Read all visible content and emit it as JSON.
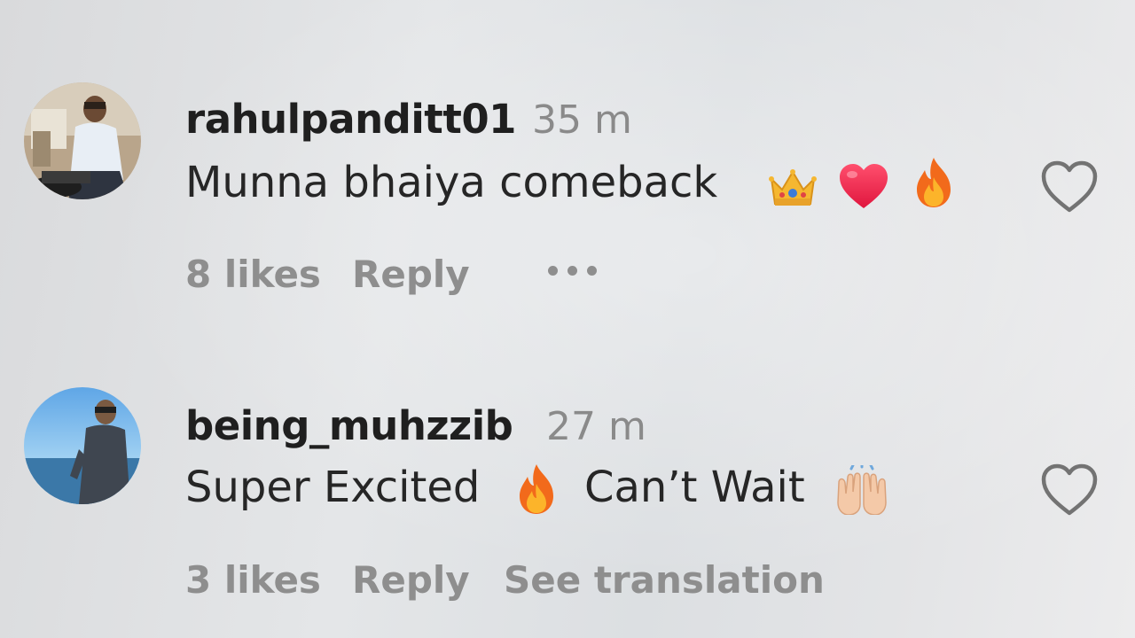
{
  "comments": [
    {
      "username": "rahulpanditt01",
      "time": "35 m",
      "text": "Munna bhaiya comeback",
      "emojis": [
        "crown-emoji",
        "red-heart-emoji",
        "fire-emoji"
      ],
      "likes": "8 likes",
      "reply": "Reply",
      "avatar_icon": "avatar-photo"
    },
    {
      "username": "being_muhzzib",
      "time": "27 m",
      "text_part1": "Super Excited",
      "text_part2": "Can’t Wait",
      "emojis": [
        "fire-emoji",
        "raising-hands-emoji"
      ],
      "likes": "3 likes",
      "reply": "Reply",
      "see_translation": "See translation",
      "avatar_icon": "avatar-photo"
    }
  ],
  "colors": {
    "username": "#1f1f1f",
    "secondary": "#8e8e8e",
    "text": "#262626"
  }
}
